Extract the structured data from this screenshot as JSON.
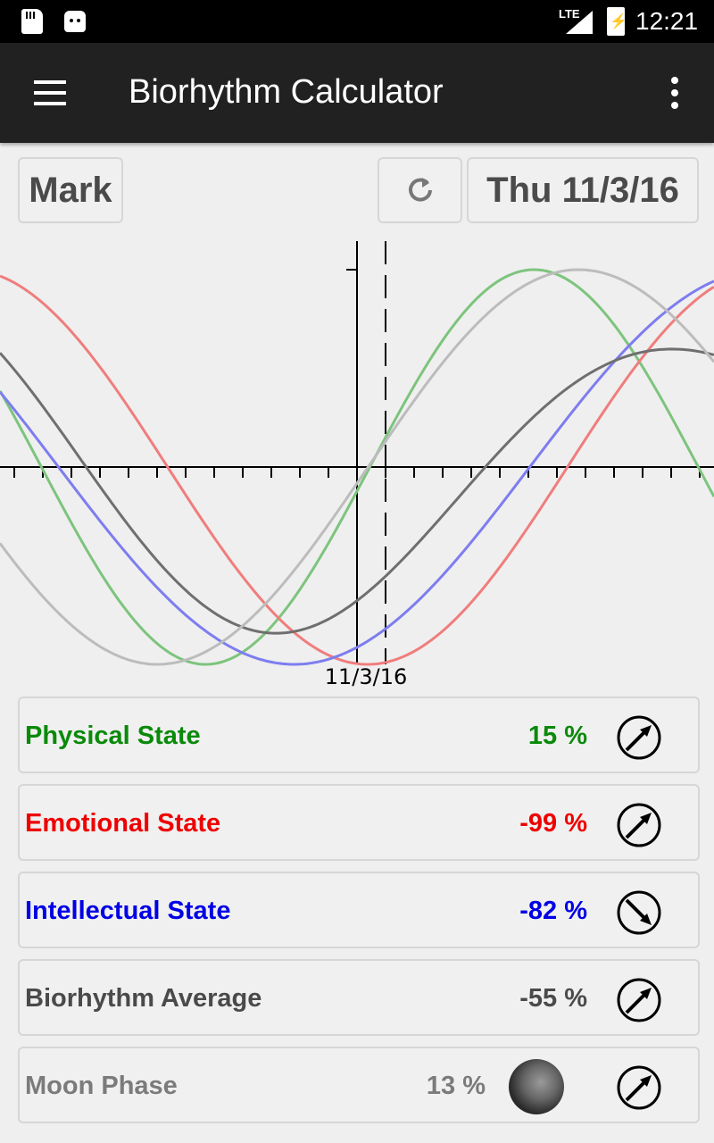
{
  "status_bar": {
    "network": "LTE",
    "time": "12:21"
  },
  "app_bar": {
    "title": "Biorhythm Calculator"
  },
  "controls": {
    "mark_label": "Mark",
    "date_label": "Thu 11/3/16"
  },
  "chart_data": {
    "type": "line",
    "xlabel": "",
    "ylabel": "",
    "x_ticks": [
      "11/3/16"
    ],
    "x_range_days": [
      -12,
      12
    ],
    "ylim": [
      -100,
      100
    ],
    "grid": false,
    "series": [
      {
        "name": "Physical",
        "color": "#7dc47d",
        "period_days": 23,
        "value_at_marker": 15
      },
      {
        "name": "Emotional",
        "color": "#f07d7d",
        "period_days": 28,
        "value_at_marker": -99
      },
      {
        "name": "Intellectual",
        "color": "#7d7df0",
        "period_days": 33,
        "value_at_marker": -82
      },
      {
        "name": "Average",
        "color": "#6f6f6f",
        "value_at_marker": -55
      },
      {
        "name": "Moon",
        "color": "#bcbcbc",
        "period_days": 29.5,
        "value_at_marker": 13
      }
    ]
  },
  "rows": [
    {
      "label": "Physical State",
      "value": "15 %",
      "color": "#0a8a0a",
      "icon": "arrow-up-right-icon"
    },
    {
      "label": "Emotional State",
      "value": "-99 %",
      "color": "#ef0000",
      "icon": "arrow-up-right-icon"
    },
    {
      "label": "Intellectual State",
      "value": "-82 %",
      "color": "#0000e6",
      "icon": "arrow-down-right-icon"
    },
    {
      "label": "Biorhythm Average",
      "value": "-55 %",
      "color": "#4a4a4a",
      "icon": "arrow-up-right-icon"
    },
    {
      "label": "Moon Phase",
      "value": "13 %",
      "color": "#7b7b7b",
      "icon": "arrow-up-right-icon"
    }
  ]
}
